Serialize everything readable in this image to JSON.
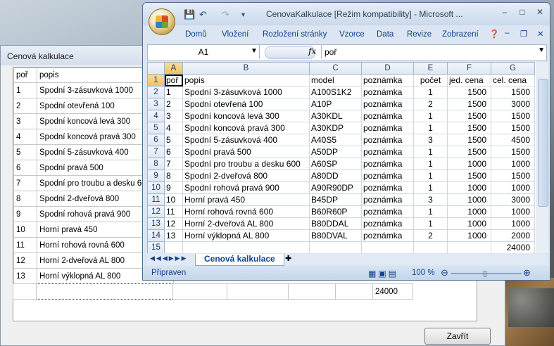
{
  "dialog": {
    "title": "Cenová kalkulace",
    "header": [
      "poř",
      "popis"
    ],
    "rows": [
      [
        "1",
        "Spodní 3-zásuvková 1000"
      ],
      [
        "2",
        "Spodní otevřená 100"
      ],
      [
        "3",
        "Spodní koncová levá 300"
      ],
      [
        "4",
        "Spodní koncová pravá 300"
      ],
      [
        "5",
        "Spodní 5-zásuvková 400"
      ],
      [
        "6",
        "Spodní pravá 500"
      ],
      [
        "7",
        "Spodní pro troubu a desku 600"
      ],
      [
        "8",
        "Spodní 2-dveřová 800"
      ],
      [
        "9",
        "Spodní rohová pravá 900"
      ],
      [
        "10",
        "Horní pravá 450"
      ],
      [
        "11",
        "Horní rohová rovná 600"
      ],
      [
        "12",
        "Horní 2-dveřová AL 800"
      ],
      [
        "13",
        "Horní výklopná AL 800"
      ]
    ],
    "total": "24000",
    "close_label": "Zavřít"
  },
  "excel": {
    "window_title": "CenovaKalkulace  [Režim kompatibility] - Microsoft ...",
    "menu": [
      "Domů",
      "Vložení",
      "Rozložení stránky",
      "Vzorce",
      "Data",
      "Revize",
      "Zobrazení"
    ],
    "name_box": "A1",
    "fx": "fx",
    "formula_value": "poř",
    "columns": [
      "A",
      "B",
      "C",
      "D",
      "E",
      "F",
      "G"
    ],
    "row_numbers": [
      "1",
      "2",
      "3",
      "4",
      "5",
      "6",
      "7",
      "8",
      "9",
      "10",
      "11",
      "12",
      "13",
      "14",
      "15"
    ],
    "header": [
      "poř",
      "popis",
      "model",
      "poznámka",
      "počet",
      "jed. cena",
      "cel. cena"
    ],
    "rows": [
      [
        "1",
        "Spodní 3-zásuvková 1000",
        "A100S1K2",
        "poznámka",
        "1",
        "1500",
        "1500"
      ],
      [
        "2",
        "Spodní otevřená 100",
        "A10P",
        "poznámka",
        "2",
        "1500",
        "3000"
      ],
      [
        "3",
        "Spodní koncová levá 300",
        "A30KDL",
        "poznámka",
        "1",
        "1500",
        "1500"
      ],
      [
        "4",
        "Spodní koncová pravá 300",
        "A30KDP",
        "poznámka",
        "1",
        "1500",
        "1500"
      ],
      [
        "5",
        "Spodní 5-zásuvková 400",
        "A40S5",
        "poznámka",
        "3",
        "1500",
        "4500"
      ],
      [
        "6",
        "Spodní pravá 500",
        "A50DP",
        "poznámka",
        "1",
        "1500",
        "1500"
      ],
      [
        "7",
        "Spodní pro troubu a desku 600",
        "A60SP",
        "poznámka",
        "1",
        "1000",
        "1000"
      ],
      [
        "8",
        "Spodní 2-dveřová 800",
        "A80DD",
        "poznámka",
        "1",
        "1500",
        "1500"
      ],
      [
        "9",
        "Spodní rohová pravá 900",
        "A90R90DP",
        "poznámka",
        "1",
        "1000",
        "1000"
      ],
      [
        "10",
        "Horní pravá 450",
        "B45DP",
        "poznámka",
        "3",
        "1000",
        "3000"
      ],
      [
        "11",
        "Horní rohová rovná 600",
        "B60R60P",
        "poznámka",
        "1",
        "1000",
        "1000"
      ],
      [
        "12",
        "Horní 2-dveřová AL 800",
        "B80DDAL",
        "poznámka",
        "1",
        "1000",
        "1000"
      ],
      [
        "13",
        "Horní výklopná AL 800",
        "B80DVAL",
        "poznámka",
        "2",
        "1000",
        "2000"
      ]
    ],
    "total": "24000",
    "sheet_tab": "Cenová kalkulace",
    "status": "Připraven",
    "zoom": "100 %"
  }
}
